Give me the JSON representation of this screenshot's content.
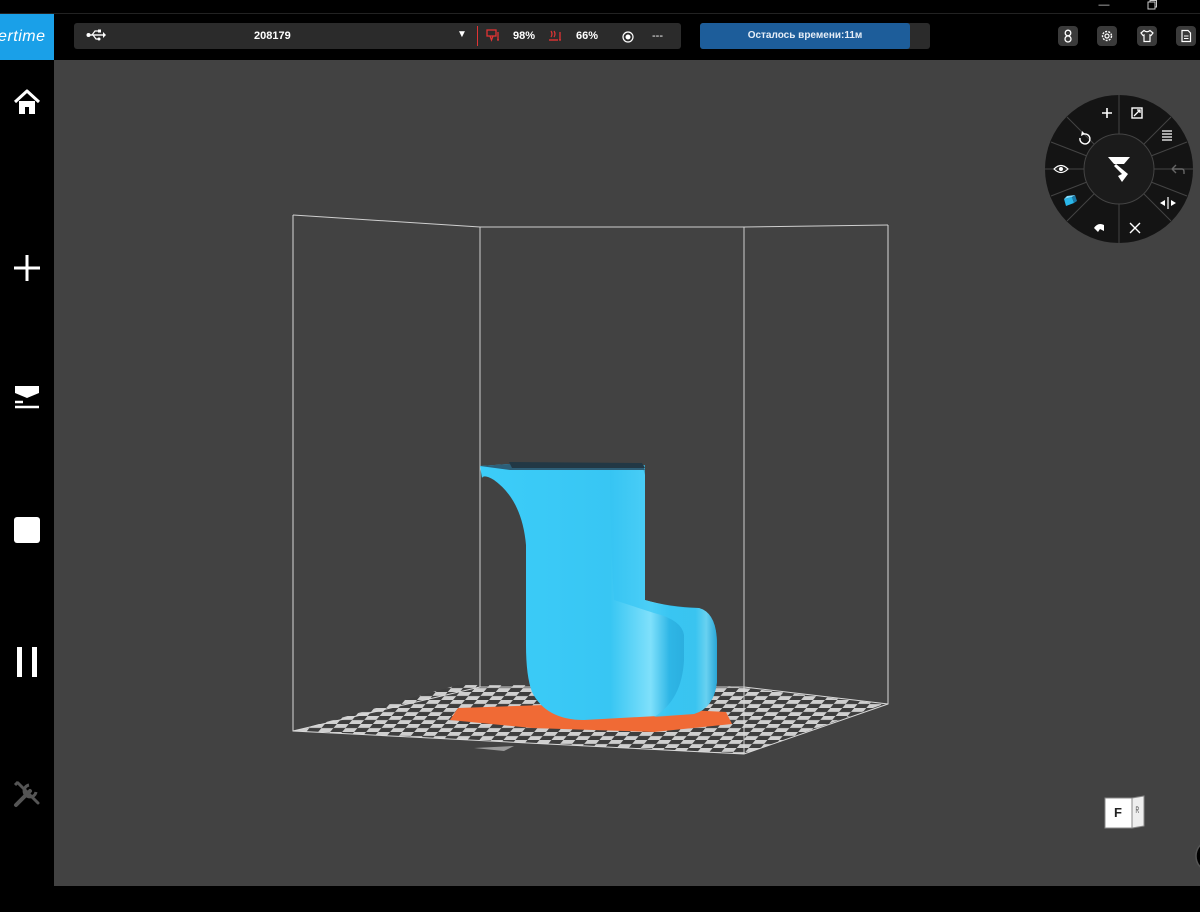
{
  "app": {
    "logo_text": "iertime"
  },
  "topbar": {
    "device_name": "208179",
    "dropdown_glyph": "▼",
    "nozzle_percent": "98%",
    "bed_percent": "66%",
    "print_value": "---",
    "time_remaining": "Осталось времени:11м"
  },
  "colors": {
    "accent": "#1aa0e8",
    "model": "#37c8f5",
    "raft": "#f06a35",
    "viewport": "#424242",
    "warning": "#e03434",
    "time_button": "#1d5d9a"
  },
  "icons": {
    "topbar": [
      "usb-icon",
      "nozzle-temp-icon",
      "bed-temp-icon",
      "record-icon",
      "user-icon",
      "settings-icon",
      "shirt-icon",
      "document-icon"
    ],
    "sidebar": [
      "home-icon",
      "add-icon",
      "print-icon",
      "stop-icon",
      "pause-icon",
      "tools-icon"
    ],
    "radial": [
      "move-icon",
      "scale-icon",
      "layers-icon",
      "undo-icon",
      "mirror-icon",
      "fit-icon",
      "support-icon",
      "cube-icon",
      "eye-icon",
      "rotate-icon",
      "center-tool-icon"
    ]
  },
  "view_cube": {
    "front_label": "F",
    "right_label": "R"
  }
}
